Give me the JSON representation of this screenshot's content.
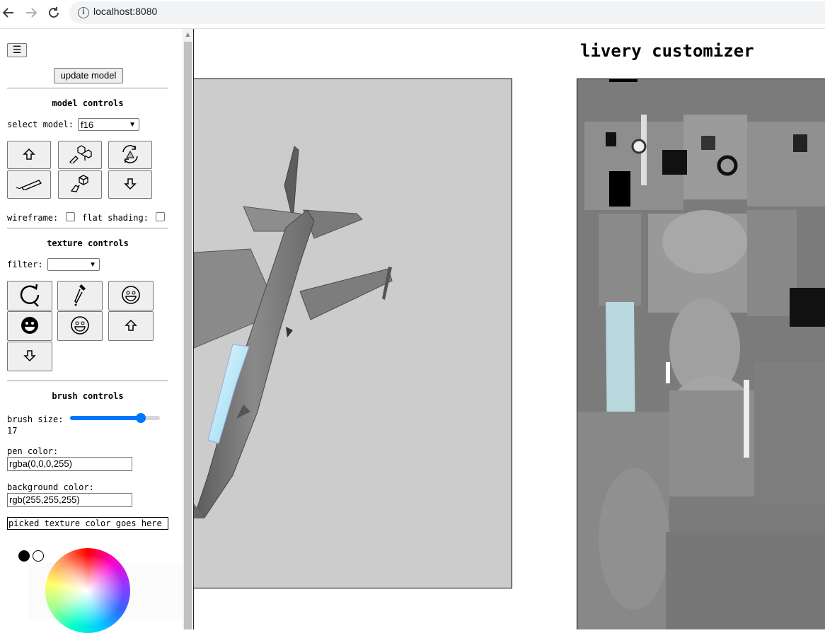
{
  "browser": {
    "url": "localhost:8080",
    "info_symbol": "i"
  },
  "sidebar": {
    "menu_glyph": "☰",
    "update_button": "update model",
    "model_controls": {
      "title": "model controls",
      "select_label": "select model:",
      "selected_model": "f16",
      "wireframe_label": "wireframe:",
      "flat_shading_label": "flat shading:",
      "wireframe_checked": false,
      "flat_shading_checked": false,
      "buttons": [
        "up-arrow-icon",
        "cubes-stack-icon",
        "rotate-camera-icon",
        "pencil-icon",
        "pointer-cube-icon",
        "down-arrow-icon"
      ]
    },
    "texture_controls": {
      "title": "texture controls",
      "filter_label": "filter:",
      "filter_value": "",
      "buttons": [
        "reset-rotate-icon",
        "eyedropper-icon",
        "smiley-outline-icon",
        "smiley-filled-icon",
        "smiley-outline-icon",
        "up-arrow-icon",
        "down-arrow-icon"
      ]
    },
    "brush_controls": {
      "title": "brush controls",
      "size_label": "brush size:",
      "size_value": "17",
      "size_fraction": 0.82,
      "pen_color_label": "pen color:",
      "pen_color_value": "rgba(0,0,0,255)",
      "bg_color_label": "background color:",
      "bg_color_value": "rgb(255,255,255)",
      "picked_text": "picked texture color goes here"
    }
  },
  "main": {
    "title": "livery customizer"
  },
  "colors": {
    "viewport_bg": "#cccccc",
    "accent": "#0075ff",
    "canopy": "#bfe9f5"
  }
}
